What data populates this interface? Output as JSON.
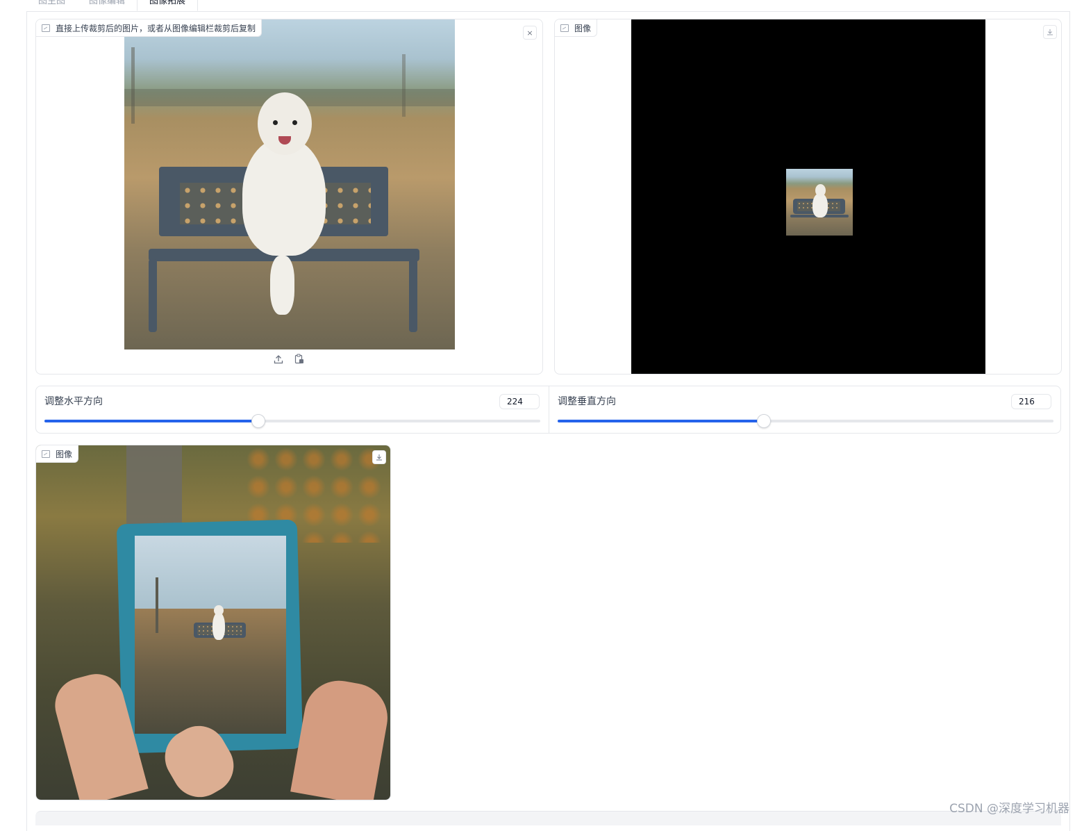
{
  "tabs": [
    {
      "label": "图生图",
      "active": false
    },
    {
      "label": "图像编辑",
      "active": false
    },
    {
      "label": "图像拓展",
      "active": true
    }
  ],
  "input_panel": {
    "label": "直接上传裁剪后的图片，或者从图像编辑栏裁剪后复制",
    "close_icon": "×",
    "upload_icon": "upload-icon",
    "paste_icon": "clipboard-icon"
  },
  "preview_panel": {
    "label": "图像",
    "download_icon": "download-icon"
  },
  "sliders": {
    "horizontal": {
      "label": "调整水平方向",
      "value": "224",
      "fraction": 0.43
    },
    "vertical": {
      "label": "调整垂直方向",
      "value": "216",
      "fraction": 0.415
    }
  },
  "output_panel": {
    "label": "图像",
    "download_icon": "download-icon"
  },
  "watermark": "CSDN @深度学习机器"
}
